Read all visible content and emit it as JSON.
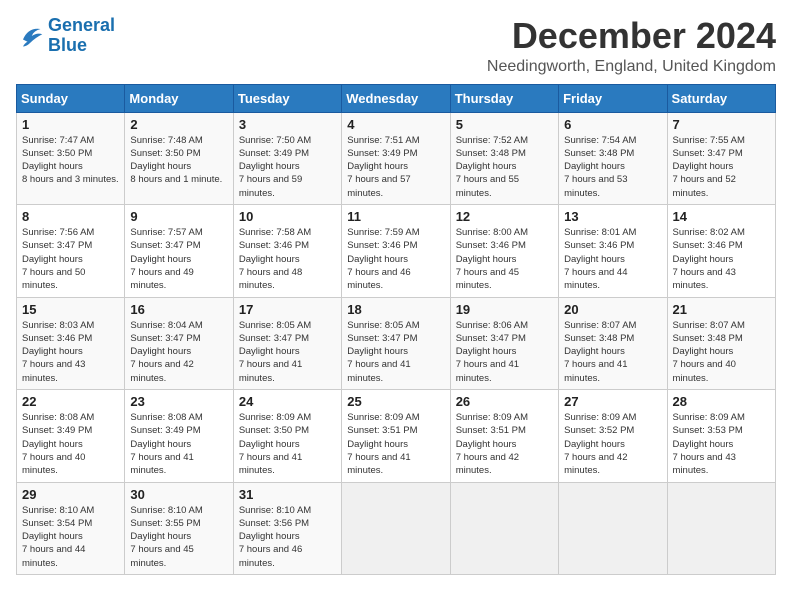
{
  "logo": {
    "line1": "General",
    "line2": "Blue"
  },
  "title": "December 2024",
  "subtitle": "Needingworth, England, United Kingdom",
  "days_of_week": [
    "Sunday",
    "Monday",
    "Tuesday",
    "Wednesday",
    "Thursday",
    "Friday",
    "Saturday"
  ],
  "weeks": [
    [
      {
        "day": "1",
        "sunrise": "7:47 AM",
        "sunset": "3:50 PM",
        "daylight": "8 hours and 3 minutes."
      },
      {
        "day": "2",
        "sunrise": "7:48 AM",
        "sunset": "3:50 PM",
        "daylight": "8 hours and 1 minute."
      },
      {
        "day": "3",
        "sunrise": "7:50 AM",
        "sunset": "3:49 PM",
        "daylight": "7 hours and 59 minutes."
      },
      {
        "day": "4",
        "sunrise": "7:51 AM",
        "sunset": "3:49 PM",
        "daylight": "7 hours and 57 minutes."
      },
      {
        "day": "5",
        "sunrise": "7:52 AM",
        "sunset": "3:48 PM",
        "daylight": "7 hours and 55 minutes."
      },
      {
        "day": "6",
        "sunrise": "7:54 AM",
        "sunset": "3:48 PM",
        "daylight": "7 hours and 53 minutes."
      },
      {
        "day": "7",
        "sunrise": "7:55 AM",
        "sunset": "3:47 PM",
        "daylight": "7 hours and 52 minutes."
      }
    ],
    [
      {
        "day": "8",
        "sunrise": "7:56 AM",
        "sunset": "3:47 PM",
        "daylight": "7 hours and 50 minutes."
      },
      {
        "day": "9",
        "sunrise": "7:57 AM",
        "sunset": "3:47 PM",
        "daylight": "7 hours and 49 minutes."
      },
      {
        "day": "10",
        "sunrise": "7:58 AM",
        "sunset": "3:46 PM",
        "daylight": "7 hours and 48 minutes."
      },
      {
        "day": "11",
        "sunrise": "7:59 AM",
        "sunset": "3:46 PM",
        "daylight": "7 hours and 46 minutes."
      },
      {
        "day": "12",
        "sunrise": "8:00 AM",
        "sunset": "3:46 PM",
        "daylight": "7 hours and 45 minutes."
      },
      {
        "day": "13",
        "sunrise": "8:01 AM",
        "sunset": "3:46 PM",
        "daylight": "7 hours and 44 minutes."
      },
      {
        "day": "14",
        "sunrise": "8:02 AM",
        "sunset": "3:46 PM",
        "daylight": "7 hours and 43 minutes."
      }
    ],
    [
      {
        "day": "15",
        "sunrise": "8:03 AM",
        "sunset": "3:46 PM",
        "daylight": "7 hours and 43 minutes."
      },
      {
        "day": "16",
        "sunrise": "8:04 AM",
        "sunset": "3:47 PM",
        "daylight": "7 hours and 42 minutes."
      },
      {
        "day": "17",
        "sunrise": "8:05 AM",
        "sunset": "3:47 PM",
        "daylight": "7 hours and 41 minutes."
      },
      {
        "day": "18",
        "sunrise": "8:05 AM",
        "sunset": "3:47 PM",
        "daylight": "7 hours and 41 minutes."
      },
      {
        "day": "19",
        "sunrise": "8:06 AM",
        "sunset": "3:47 PM",
        "daylight": "7 hours and 41 minutes."
      },
      {
        "day": "20",
        "sunrise": "8:07 AM",
        "sunset": "3:48 PM",
        "daylight": "7 hours and 41 minutes."
      },
      {
        "day": "21",
        "sunrise": "8:07 AM",
        "sunset": "3:48 PM",
        "daylight": "7 hours and 40 minutes."
      }
    ],
    [
      {
        "day": "22",
        "sunrise": "8:08 AM",
        "sunset": "3:49 PM",
        "daylight": "7 hours and 40 minutes."
      },
      {
        "day": "23",
        "sunrise": "8:08 AM",
        "sunset": "3:49 PM",
        "daylight": "7 hours and 41 minutes."
      },
      {
        "day": "24",
        "sunrise": "8:09 AM",
        "sunset": "3:50 PM",
        "daylight": "7 hours and 41 minutes."
      },
      {
        "day": "25",
        "sunrise": "8:09 AM",
        "sunset": "3:51 PM",
        "daylight": "7 hours and 41 minutes."
      },
      {
        "day": "26",
        "sunrise": "8:09 AM",
        "sunset": "3:51 PM",
        "daylight": "7 hours and 42 minutes."
      },
      {
        "day": "27",
        "sunrise": "8:09 AM",
        "sunset": "3:52 PM",
        "daylight": "7 hours and 42 minutes."
      },
      {
        "day": "28",
        "sunrise": "8:09 AM",
        "sunset": "3:53 PM",
        "daylight": "7 hours and 43 minutes."
      }
    ],
    [
      {
        "day": "29",
        "sunrise": "8:10 AM",
        "sunset": "3:54 PM",
        "daylight": "7 hours and 44 minutes."
      },
      {
        "day": "30",
        "sunrise": "8:10 AM",
        "sunset": "3:55 PM",
        "daylight": "7 hours and 45 minutes."
      },
      {
        "day": "31",
        "sunrise": "8:10 AM",
        "sunset": "3:56 PM",
        "daylight": "7 hours and 46 minutes."
      },
      null,
      null,
      null,
      null
    ]
  ]
}
